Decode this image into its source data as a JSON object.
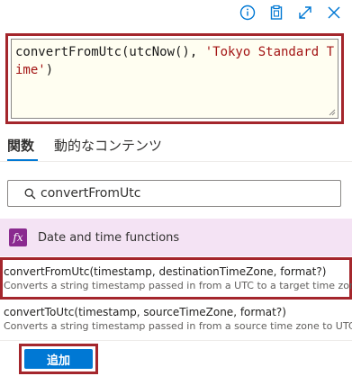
{
  "toolbar": {
    "icons": [
      "info-icon",
      "clipboard-icon",
      "expand-icon",
      "close-icon"
    ]
  },
  "editor": {
    "code_prefix": "convertFromUtc(utcNow(), ",
    "code_string": "'Tokyo Standard Time'",
    "code_suffix": ")"
  },
  "tabs": [
    {
      "label": "関数",
      "active": true
    },
    {
      "label": "動的なコンテンツ",
      "active": false
    }
  ],
  "search": {
    "value": "convertFromUtc"
  },
  "category": {
    "icon_text": "fx",
    "label": "Date and time functions",
    "color": "#8a2a8f",
    "background": "#f4e3f4"
  },
  "functions": [
    {
      "signature": "convertFromUtc(timestamp, destinationTimeZone, format?)",
      "description": "Converts a string timestamp passed in from a UTC to a target time zone",
      "selected": true
    },
    {
      "signature": "convertToUtc(timestamp, sourceTimeZone, format?)",
      "description": "Converts a string timestamp passed in from a source time zone to UTC",
      "selected": false
    }
  ],
  "actions": {
    "add_label": "追加"
  },
  "colors": {
    "accent": "#0078d4",
    "highlight_border": "#a4262c"
  }
}
